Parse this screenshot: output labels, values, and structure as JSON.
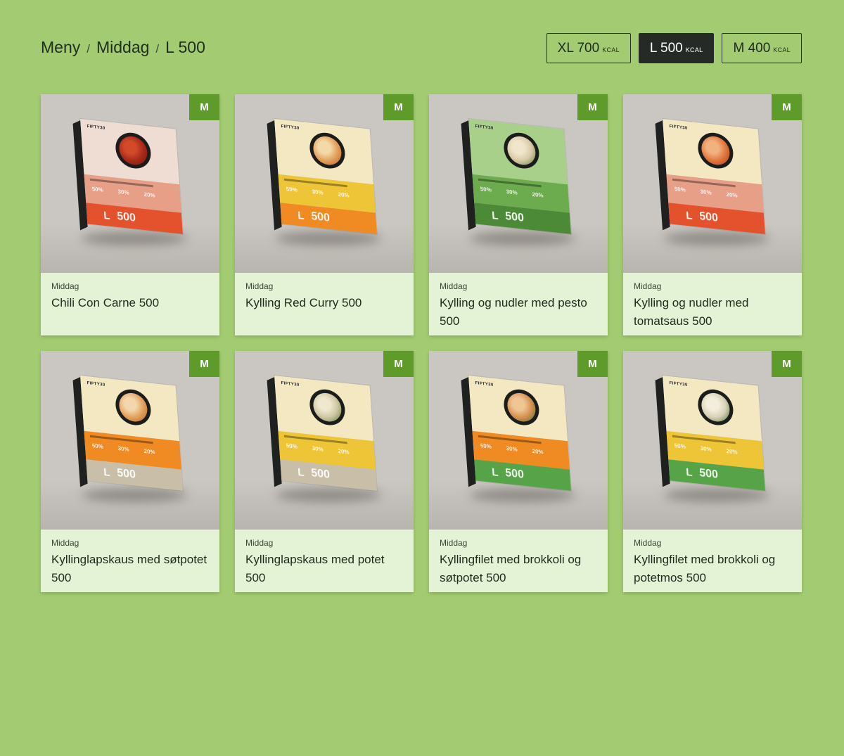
{
  "breadcrumb": {
    "items": [
      "Meny",
      "Middag",
      "L 500"
    ],
    "separator": "/"
  },
  "size_options": [
    {
      "label": "XL 700",
      "unit": "KCAL",
      "active": false
    },
    {
      "label": "L 500",
      "unit": "KCAL",
      "active": true
    },
    {
      "label": "M 400",
      "unit": "KCAL",
      "active": false
    }
  ],
  "colors": {
    "background": "#a3cc72",
    "card_bg": "#e4f2d6",
    "badge": "#5f9b2b",
    "active_button": "#262a26"
  },
  "products": [
    {
      "category": "Middag",
      "title": "Chili Con Carne 500",
      "badge": "M",
      "pack": {
        "logo": "FIFTY30",
        "size": "L",
        "kcal": "500",
        "percents": [
          "50%",
          "30%",
          "20%"
        ],
        "top": "#efdcd3",
        "mid": "#e79f88",
        "bot": "#e4512d",
        "food": "#a82a1a",
        "food2": "#d24a2a",
        "food3": "#6e170d"
      }
    },
    {
      "category": "Middag",
      "title": "Kylling Red Curry 500",
      "badge": "M",
      "pack": {
        "logo": "FIFTY30",
        "size": "L",
        "kcal": "500",
        "percents": [
          "50%",
          "30%",
          "20%"
        ],
        "top": "#f3e8c2",
        "mid": "#eec536",
        "bot": "#f08a22",
        "food": "#e2a05a",
        "food2": "#f4d9a8",
        "food3": "#c25a2c"
      }
    },
    {
      "category": "Middag",
      "title": "Kylling og nudler med pesto 500",
      "badge": "M",
      "pack": {
        "logo": "FIFTY30",
        "size": "L",
        "kcal": "500",
        "percents": [
          "50%",
          "30%",
          "20%"
        ],
        "top": "#a8d08a",
        "mid": "#6cab4e",
        "bot": "#4d8a38",
        "food": "#d8c9a6",
        "food2": "#f1e6cc",
        "food3": "#4f7a3a"
      }
    },
    {
      "category": "Middag",
      "title": "Kylling og nudler med tomatsaus 500",
      "badge": "M",
      "pack": {
        "logo": "FIFTY30",
        "size": "L",
        "kcal": "500",
        "percents": [
          "50%",
          "30%",
          "20%"
        ],
        "top": "#f3e8c2",
        "mid": "#e79f88",
        "bot": "#e4512d",
        "food": "#e1763f",
        "food2": "#f1b27f",
        "food3": "#9b3a1d"
      }
    },
    {
      "category": "Middag",
      "title": "Kyllinglapskaus med søtpotet 500",
      "badge": "M",
      "pack": {
        "logo": "FIFTY30",
        "size": "L",
        "kcal": "500",
        "percents": [
          "50%",
          "30%",
          "20%"
        ],
        "top": "#f3e8c2",
        "mid": "#f08a22",
        "bot": "#c9bfa8",
        "food": "#e3a15e",
        "food2": "#f3d6ad",
        "food3": "#a7612a"
      }
    },
    {
      "category": "Middag",
      "title": "Kyllinglapskaus med potet 500",
      "badge": "M",
      "pack": {
        "logo": "FIFTY30",
        "size": "L",
        "kcal": "500",
        "percents": [
          "50%",
          "30%",
          "20%"
        ],
        "top": "#f3e8c2",
        "mid": "#eec536",
        "bot": "#c9bfa8",
        "food": "#cfc6a2",
        "food2": "#efe8cf",
        "food3": "#4f7a3a"
      }
    },
    {
      "category": "Middag",
      "title": "Kyllingfilet med brokkoli og søtpotet 500",
      "badge": "M",
      "pack": {
        "logo": "FIFTY30",
        "size": "L",
        "kcal": "500",
        "percents": [
          "50%",
          "30%",
          "20%"
        ],
        "top": "#f3e8c2",
        "mid": "#f08a22",
        "bot": "#56a447",
        "food": "#d59152",
        "food2": "#f0c594",
        "food3": "#3f6e32"
      }
    },
    {
      "category": "Middag",
      "title": "Kyllingfilet med brokkoli og potetmos 500",
      "badge": "M",
      "pack": {
        "logo": "FIFTY30",
        "size": "L",
        "kcal": "500",
        "percents": [
          "50%",
          "30%",
          "20%"
        ],
        "top": "#f3e8c2",
        "mid": "#eec536",
        "bot": "#56a447",
        "food": "#d8d0b6",
        "food2": "#f3eedc",
        "food3": "#3f6e32"
      }
    }
  ]
}
